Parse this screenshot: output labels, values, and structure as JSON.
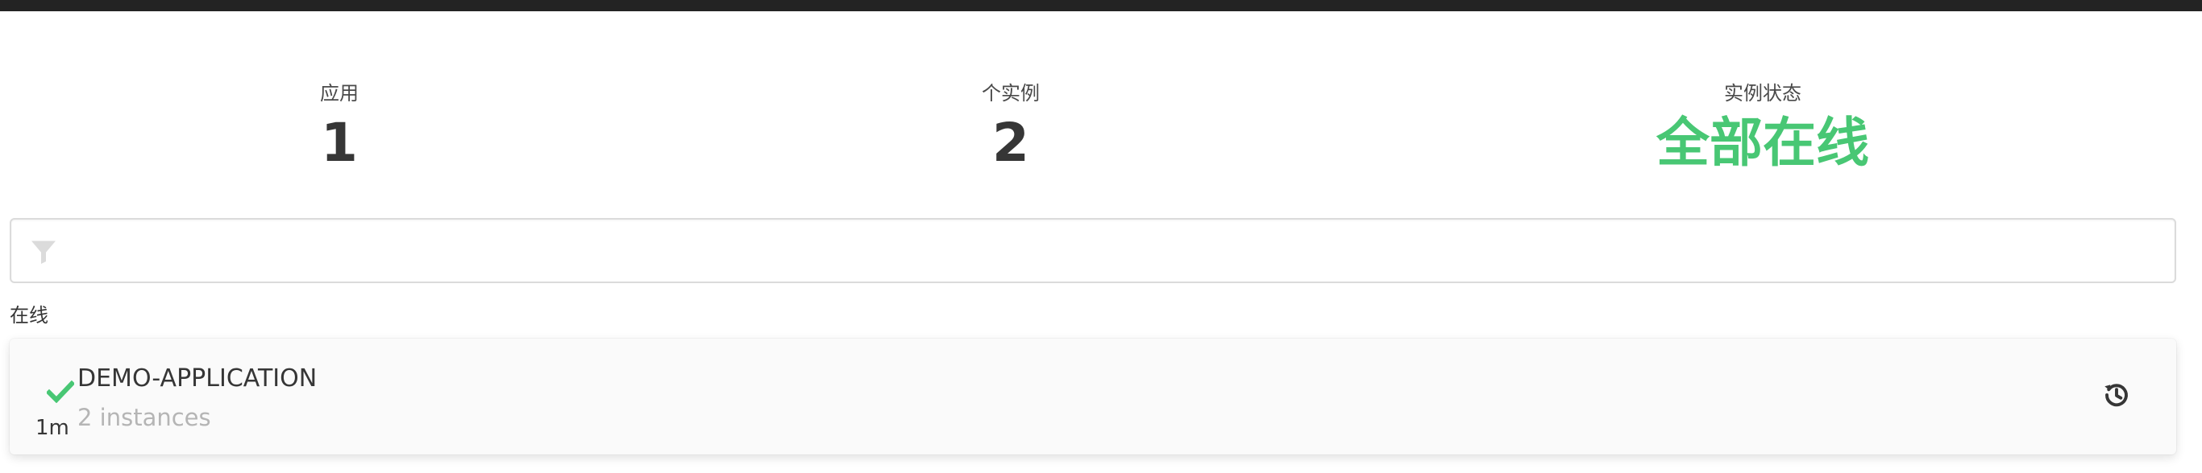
{
  "stats": [
    {
      "label": "应用",
      "value": "1"
    },
    {
      "label": "个实例",
      "value": "2"
    },
    {
      "label": "实例状态",
      "value": "全部在线"
    }
  ],
  "colors": {
    "topbar": "#232323",
    "success": "#48c774",
    "muted_text": "#b5b5b5",
    "text": "#363636"
  },
  "filter": {
    "icon": "filter-icon",
    "value": "",
    "placeholder": ""
  },
  "groups": [
    {
      "label": "在线",
      "applications": [
        {
          "status_icon": "check-icon",
          "since": "1m",
          "name": "DEMO-APPLICATION",
          "instances_text": "2 instances",
          "action_icon": "history-icon"
        }
      ]
    }
  ]
}
